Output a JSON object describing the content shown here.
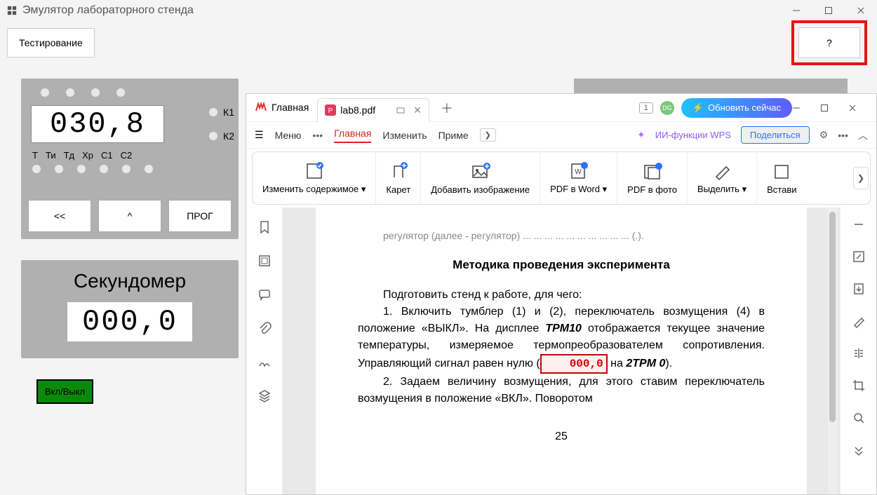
{
  "app": {
    "title": "Эмулятор лабораторного стенда"
  },
  "toolbar": {
    "testing": "Тестирование",
    "help": "?"
  },
  "display": {
    "value": "030,8",
    "k1": "К1",
    "k2": "К2",
    "labels": {
      "t": "Т",
      "ti": "Ти",
      "td": "Тд",
      "xp": "Хр",
      "c1": "С1",
      "c2": "С2"
    }
  },
  "buttons": {
    "prev": "<<",
    "up": "^",
    "prog": "ПРОГ"
  },
  "stopwatch": {
    "title": "Секундомер",
    "value": "000,0"
  },
  "power": {
    "label": "Вкл/Выкл"
  },
  "wps": {
    "tabs": {
      "home": "Главная",
      "doc": "lab8.pdf"
    },
    "badge": "1",
    "avatar": "DG",
    "update": "Обновить сейчас",
    "menu": {
      "burger": "Меню",
      "home": "Главная",
      "edit": "Изменить",
      "apply": "Приме"
    },
    "ai": "ИИ-функции WPS",
    "share": "Поделиться",
    "ribbon": {
      "edit_content": "Изменить содержимое",
      "caret": "Карет",
      "add_image": "Добавить изображение",
      "pdf_to_word": "PDF в Word",
      "pdf_to_photo": "PDF в фото",
      "highlight": "Выделить",
      "insert": "Встави"
    },
    "doc": {
      "line0": "регулятор (далее - регулятор) ... ... ... ... ... ... ... ... ... ... (.).",
      "title": "Методика проведения эксперимента",
      "line1": "Подготовить стенд к работе, для чего:",
      "item1a": "1. Включить тумблер (1) и (2), переключатель возмущения (4) в положение «ВЫКЛ». На дисплее ",
      "trm10": "ТРМ10",
      "item1b": " отображается текущее значение температуры, измеряемое термопреобразователем сопротивления. Управляющий сигнал равен нулю (",
      "led": "000,0",
      "item1c": " на ",
      "trm0": "2ТРМ 0",
      "item1d": ").",
      "item2": "2. Задаем величину возмущения, для этого ставим переключатель возмущения в положение «ВКЛ». Поворотом",
      "pagenum": "25"
    }
  }
}
